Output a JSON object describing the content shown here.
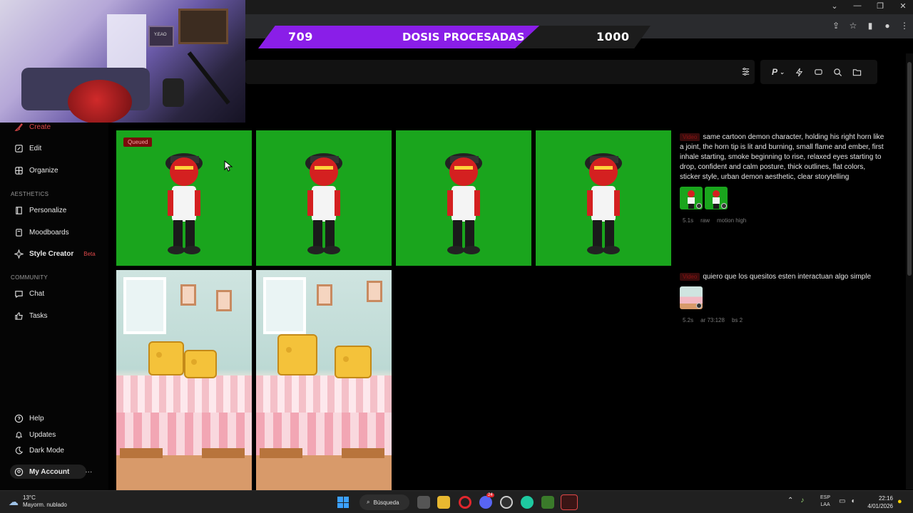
{
  "overlay": {
    "count_done": "709",
    "title": "DOSIS PROCESADAS",
    "count_target": "1000",
    "webcam_sign": "Y.EAO"
  },
  "window_controls": [
    "⌄",
    "—",
    "❐",
    "✕"
  ],
  "sidebar": {
    "create_label": "Create",
    "edit_label": "Edit",
    "organize_label": "Organize",
    "aesthetics_label": "AESTHETICS",
    "personalize_label": "Personalize",
    "moodboards_label": "Moodboards",
    "style_creator_label": "Style Creator",
    "beta_label": "Beta",
    "community_label": "COMMUNITY",
    "chat_label": "Chat",
    "tasks_label": "Tasks",
    "help_label": "Help",
    "updates_label": "Updates",
    "dark_mode_label": "Dark Mode",
    "account_label": "My Account",
    "account_more": "···"
  },
  "toolbar": {
    "profile_label": "P",
    "icons": [
      "filter-icon",
      "profile-menu",
      "bolt-icon",
      "chat-bubble-icon",
      "search-icon",
      "folder-icon"
    ]
  },
  "grid": {
    "queued_label": "Queued"
  },
  "prompts": [
    {
      "tag": "Video",
      "text": "same cartoon demon character, holding his right horn like a joint, the horn tip is lit and burning, small flame and ember, first inhale starting, smoke beginning to rise, relaxed eyes starting to drop, confident and calm posture, thick outlines, flat colors, sticker style, urban demon aesthetic, clear storytelling",
      "meta": [
        "5.1s",
        "raw",
        "motion high"
      ]
    },
    {
      "tag": "Video",
      "text": "quiero que los quesitos esten interactuan algo simple",
      "meta": [
        "5.2s",
        "ar 73:128",
        "bs 2"
      ]
    }
  ],
  "taskbar": {
    "temperature": "13°C",
    "weather_desc": "Mayorm. nublado",
    "search_label": "Búsqueda",
    "discord_badge": "24",
    "lang_top": "ESP",
    "lang_bottom": "LAA",
    "time": "22:16",
    "date": "4/01/2026"
  },
  "colors": {
    "accent_red": "#e0484a",
    "overlay_purple": "#8a1ee8",
    "green_screen": "#1aa51d"
  }
}
